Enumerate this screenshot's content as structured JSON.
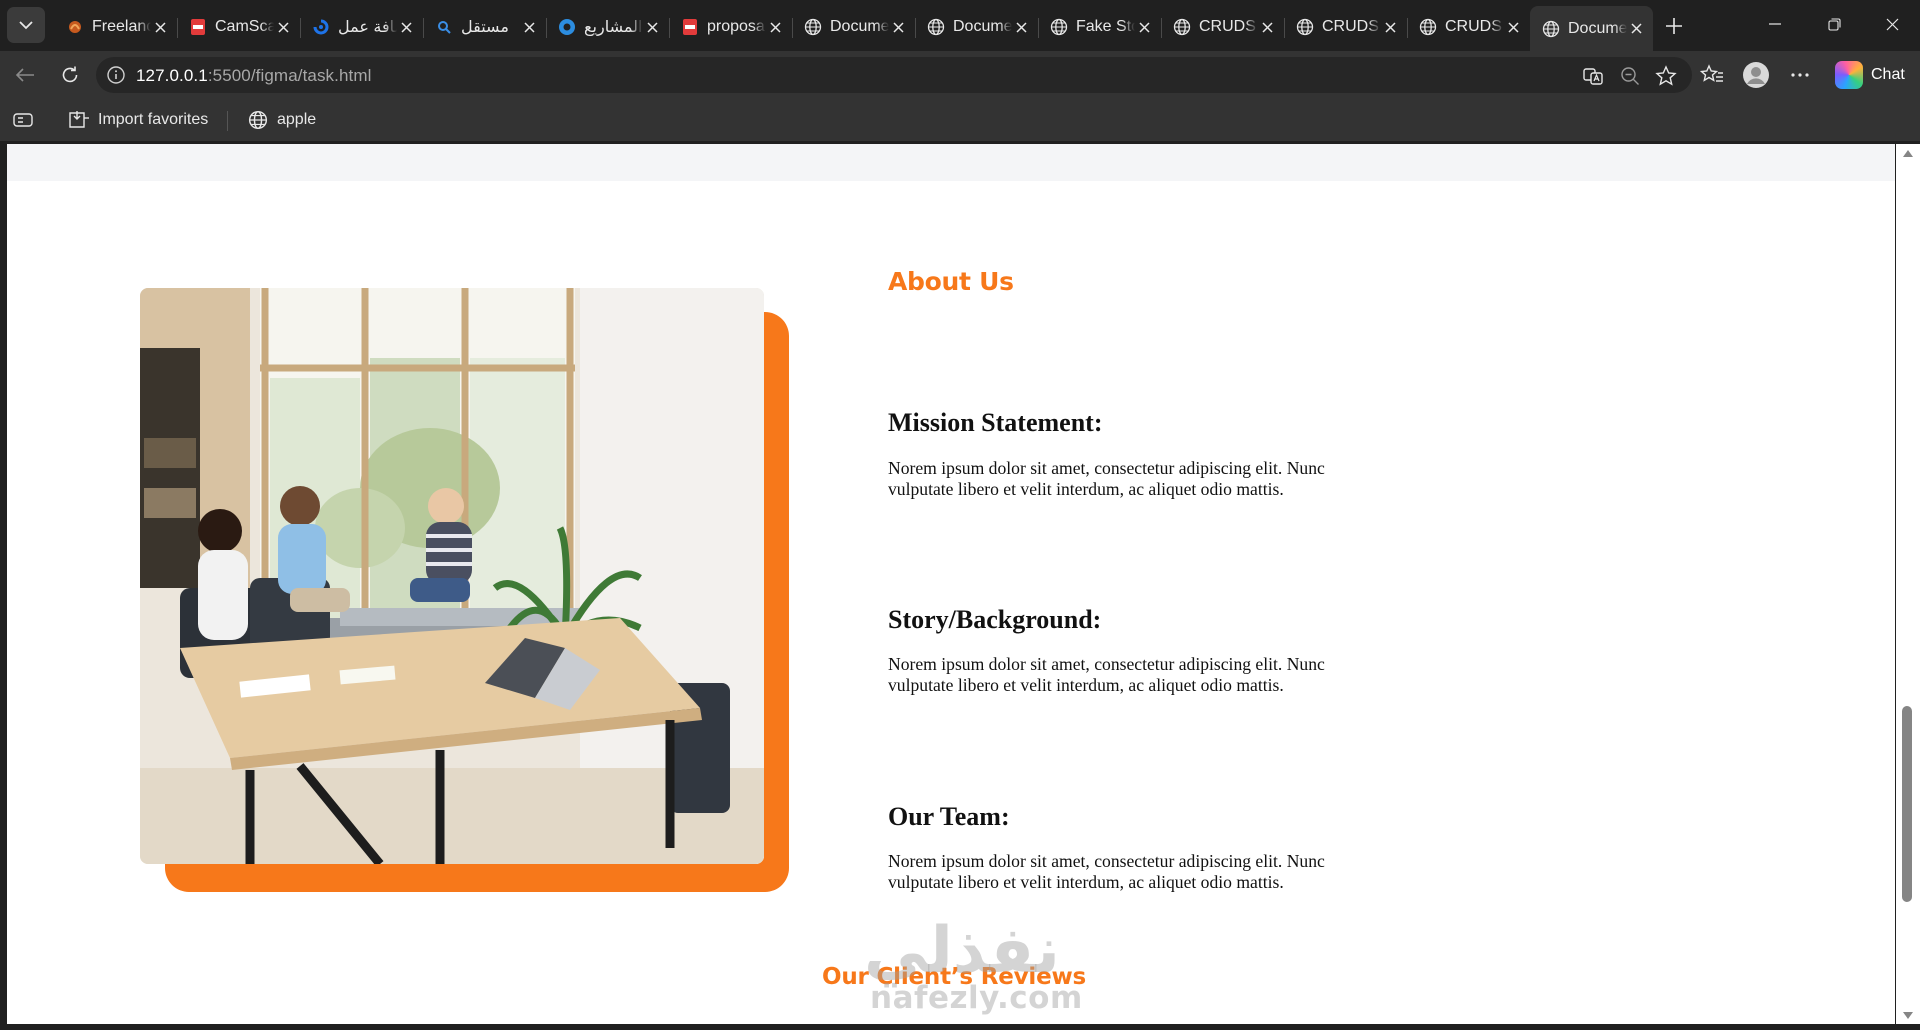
{
  "browser": {
    "tabs": [
      {
        "title": "Freelancer",
        "icon": "freelancer-favicon",
        "active": false
      },
      {
        "title": "CamScanner",
        "icon": "pdf-favicon",
        "active": false
      },
      {
        "title": "إضافة عمل",
        "icon": "blue-swirl-favicon",
        "active": false
      },
      {
        "title": "مستقل",
        "icon": "search-favicon",
        "active": false
      },
      {
        "title": "المشاريع",
        "icon": "ring-favicon",
        "active": false
      },
      {
        "title": "proposal",
        "icon": "pdf-favicon",
        "active": false
      },
      {
        "title": "Document",
        "icon": "globe-icon",
        "active": false
      },
      {
        "title": "Document",
        "icon": "globe-icon",
        "active": false
      },
      {
        "title": "Fake Store",
        "icon": "globe-icon",
        "active": false
      },
      {
        "title": "CRUDS",
        "icon": "globe-icon",
        "active": false
      },
      {
        "title": "CRUDS",
        "icon": "globe-icon",
        "active": false
      },
      {
        "title": "CRUDS",
        "icon": "globe-icon",
        "active": false
      },
      {
        "title": "Document",
        "icon": "globe-icon",
        "active": true
      }
    ],
    "address": {
      "host": "127.0.0.1",
      "rest": ":5500/figma/task.html"
    },
    "copilot_label": "Chat",
    "favorites": [
      {
        "label": "Import favorites",
        "icon": "import-favorites-icon"
      },
      {
        "label": "apple",
        "icon": "globe-icon"
      }
    ]
  },
  "page": {
    "about_title": "About Us",
    "sections": [
      {
        "heading": "Mission Statement:",
        "body": "Norem ipsum dolor sit amet, consectetur adipiscing elit. Nunc vulputate libero et velit interdum, ac aliquet odio mattis."
      },
      {
        "heading": "Story/Background:",
        "body": "Norem ipsum dolor sit amet, consectetur adipiscing elit. Nunc vulputate libero et velit interdum, ac aliquet odio mattis."
      },
      {
        "heading": "Our Team:",
        "body": "Norem ipsum dolor sit amet, consectetur adipiscing elit. Nunc vulputate libero et velit interdum, ac aliquet odio mattis."
      }
    ],
    "reviews_title": "Our Client’s Reviews",
    "watermark": {
      "arabic": "نفذلي",
      "latin": "nafezly.com"
    }
  },
  "colors": {
    "accent": "#f7781a",
    "tab_bg": "#202020",
    "toolbar_bg": "#333333"
  }
}
